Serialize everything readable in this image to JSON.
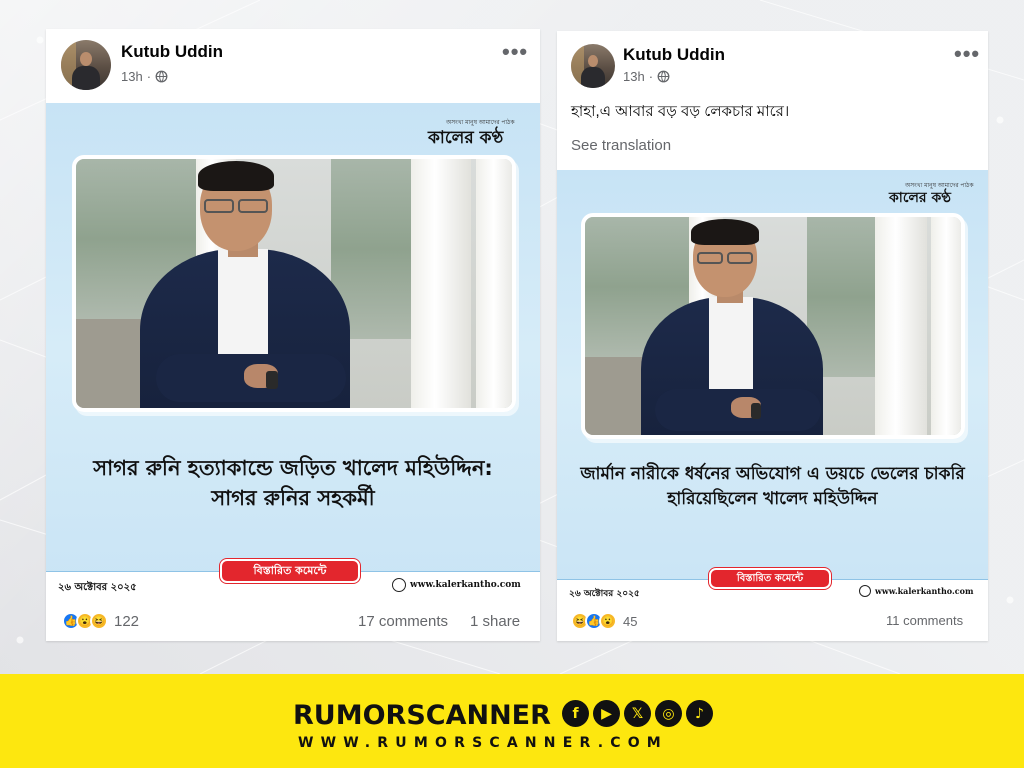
{
  "posts": [
    {
      "author": "Kutub Uddin",
      "time": "13h",
      "more_label": "•••",
      "card": {
        "masthead_tag": "অসংখ্য মানুষ আমাদের পাঠক",
        "masthead": "কালের কণ্ঠ",
        "headline": "সাগর রুনি হত্যাকান্ডে জড়িত খালেদ মহিউদ্দিন: সাগর রুনির সহকর্মী",
        "date": "২৬ অক্টোবর ২০২৫",
        "button": "বিস্তারিত কমেন্টে",
        "site": "www.kalerkantho.com"
      },
      "reaction_count": "122",
      "comments": "17 comments",
      "shares": "1 share"
    },
    {
      "author": "Kutub Uddin",
      "time": "13h",
      "more_label": "•••",
      "text": "হাহা,এ আবার বড় বড় লেকচার মারে।",
      "see_translation": "See translation",
      "card": {
        "masthead_tag": "অসংখ্য মানুষ আমাদের পাঠক",
        "masthead": "কালের কণ্ঠ",
        "headline": "জার্মান নারীকে ধর্ষনের অভিযোগ এ ডয়চে ভেলের চাকরি হারিয়েছিলেন খালেদ মহিউদ্দিন",
        "date": "২৬ অক্টোবর ২০২৫",
        "button": "বিস্তারিত কমেন্টে",
        "site": "www.kalerkantho.com"
      },
      "reaction_count": "45",
      "comments": "11 comments"
    }
  ],
  "banner": {
    "brand": "RUMORSCANNER",
    "url": "WWW.RUMORSCANNER.COM",
    "social": [
      {
        "icon": "facebook-icon",
        "glyph": "f"
      },
      {
        "icon": "youtube-icon",
        "glyph": "▶"
      },
      {
        "icon": "x-icon",
        "glyph": "𝕏"
      },
      {
        "icon": "instagram-icon",
        "glyph": "◎"
      },
      {
        "icon": "tiktok-icon",
        "glyph": "♪"
      }
    ],
    "color": "#fde70f"
  },
  "colors": {
    "facebook_blue": "#1877f2",
    "details_red": "#e3262d",
    "card_blue": "#c7e3f5"
  }
}
